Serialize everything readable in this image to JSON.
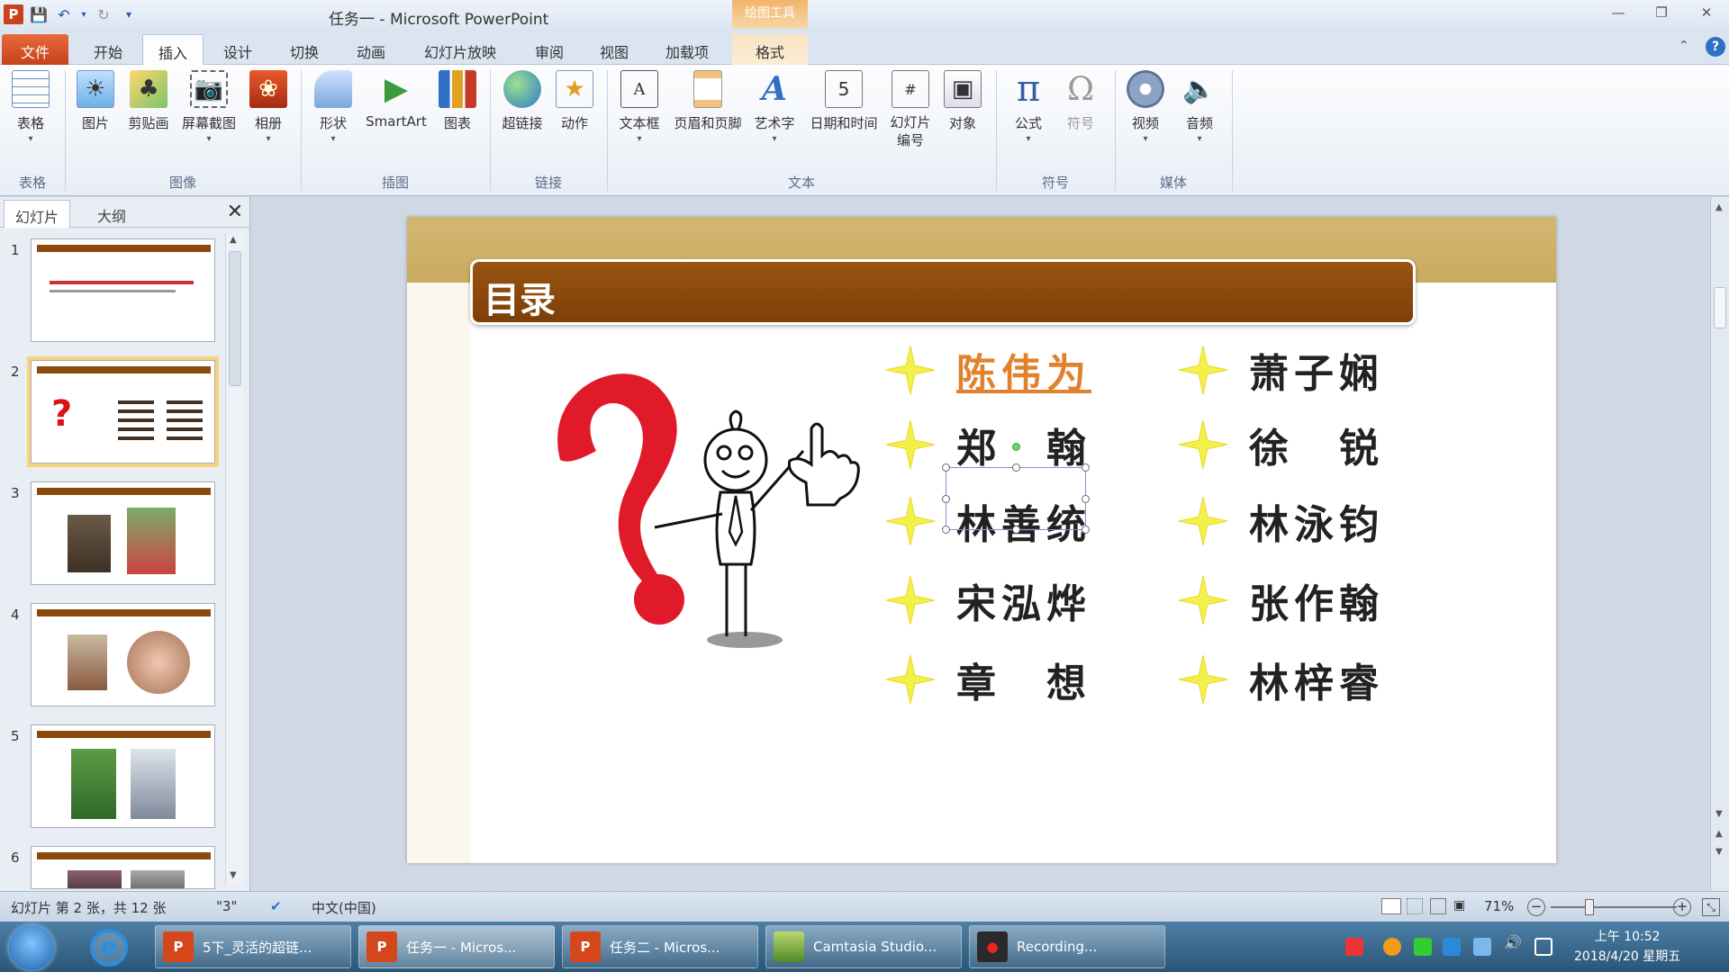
{
  "window": {
    "title": "任务一 - Microsoft PowerPoint",
    "context_tab_header": "绘图工具"
  },
  "tabs": [
    {
      "label": "文件"
    },
    {
      "label": "开始"
    },
    {
      "label": "插入"
    },
    {
      "label": "设计"
    },
    {
      "label": "切换"
    },
    {
      "label": "动画"
    },
    {
      "label": "幻灯片放映"
    },
    {
      "label": "审阅"
    },
    {
      "label": "视图"
    },
    {
      "label": "加载项"
    },
    {
      "label": "格式"
    }
  ],
  "ribbon": {
    "buttons": [
      {
        "label": "表格",
        "icon": "table-icon"
      },
      {
        "label": "图片",
        "icon": "picture-icon"
      },
      {
        "label": "剪贴画",
        "icon": "clipart-icon"
      },
      {
        "label": "屏幕截图",
        "icon": "screenshot-icon"
      },
      {
        "label": "相册",
        "icon": "album-icon"
      },
      {
        "label": "形状",
        "icon": "shapes-icon"
      },
      {
        "label": "SmartArt",
        "icon": "smartart-icon"
      },
      {
        "label": "图表",
        "icon": "chart-icon"
      },
      {
        "label": "超链接",
        "icon": "hyperlink-icon"
      },
      {
        "label": "动作",
        "icon": "action-icon"
      },
      {
        "label": "文本框",
        "icon": "textbox-icon"
      },
      {
        "label": "页眉和页脚",
        "icon": "header-footer-icon"
      },
      {
        "label": "艺术字",
        "icon": "wordart-icon"
      },
      {
        "label": "日期和时间",
        "icon": "datetime-icon"
      },
      {
        "label": "幻灯片\n编号",
        "icon": "slide-number-icon"
      },
      {
        "label": "对象",
        "icon": "object-icon"
      },
      {
        "label": "公式",
        "icon": "equation-icon"
      },
      {
        "label": "符号",
        "icon": "symbol-icon"
      },
      {
        "label": "视频",
        "icon": "video-icon"
      },
      {
        "label": "音频",
        "icon": "audio-icon"
      }
    ],
    "groups": [
      "表格",
      "图像",
      "插图",
      "链接",
      "文本",
      "符号",
      "媒体"
    ]
  },
  "left_pane": {
    "tabs": [
      "幻灯片",
      "大纲"
    ],
    "slides": [
      {
        "number": "1"
      },
      {
        "number": "2"
      },
      {
        "number": "3"
      },
      {
        "number": "4"
      },
      {
        "number": "5"
      },
      {
        "number": "6"
      }
    ]
  },
  "slide": {
    "title": "目录",
    "names_left": [
      "陈伟为",
      "郑　翰",
      "林善统",
      "宋泓烨",
      "章　想"
    ],
    "names_right": [
      "萧子娴",
      "徐　锐",
      "林泳钧",
      "张作翰",
      "林梓睿"
    ],
    "colors": {
      "title_bar": "#8a4a0c",
      "band": "#cdb066",
      "link": "#e0822c",
      "star": "#f4f04a"
    }
  },
  "status": {
    "slide_info": "幻灯片 第 2 张，共 12 张",
    "theme": "\"3\"",
    "language": "中文(中国)",
    "zoom": "71%"
  },
  "taskbar": {
    "tasks": [
      {
        "label": "5下_灵活的超链..."
      },
      {
        "label": "任务一 - Micros..."
      },
      {
        "label": "任务二 - Micros..."
      },
      {
        "label": "Camtasia Studio..."
      },
      {
        "label": "Recording..."
      }
    ],
    "clock_time": "上午 10:52",
    "clock_date": "2018/4/20 星期五"
  }
}
